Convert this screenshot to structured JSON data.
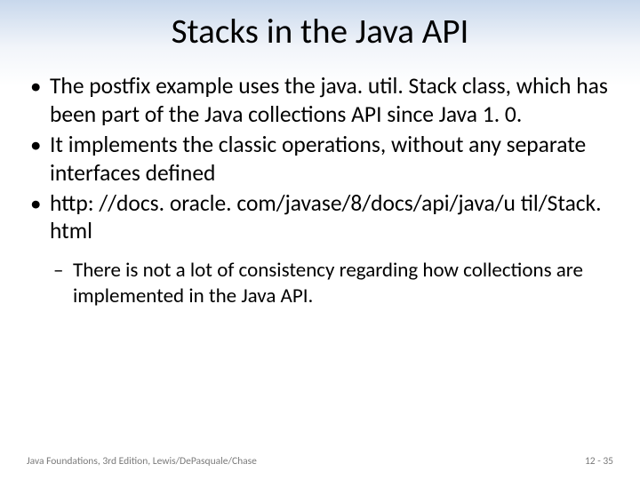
{
  "title": "Stacks in the Java API",
  "bullets": {
    "b1": "The postfix example uses the java. util. Stack class, which has been part of the Java collections API since Java 1. 0.",
    "b2": "It implements the classic operations, without any separate interfaces defined",
    "b3": "http: //docs. oracle. com/javase/8/docs/api/java/u til/Stack. html"
  },
  "subbullets": {
    "s1": "There is not a lot of consistency regarding how collections are implemented in the Java API."
  },
  "footer": {
    "left": "Java Foundations, 3rd Edition, Lewis/DePasquale/Chase",
    "right": "12 - 35"
  }
}
